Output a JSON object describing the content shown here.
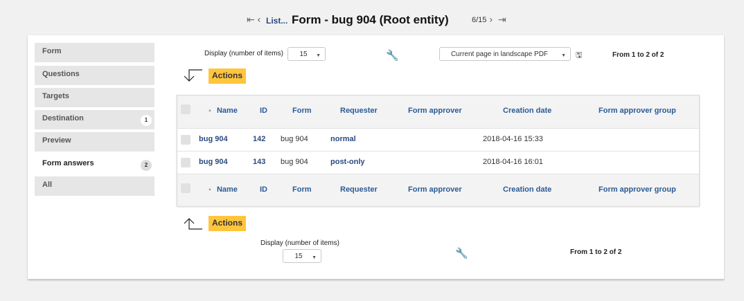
{
  "header": {
    "first_glyph": "⟨",
    "prev_glyph": "‹",
    "list_label": "List...",
    "title": "Form - bug 904 (Root entity)",
    "position": "6/15",
    "next_glyph": "›",
    "last_glyph": "⟩"
  },
  "sidebar": {
    "items": [
      {
        "label": "Form",
        "badge": ""
      },
      {
        "label": "Questions",
        "badge": ""
      },
      {
        "label": "Targets",
        "badge": ""
      },
      {
        "label": "Destination",
        "badge": "1"
      },
      {
        "label": "Preview",
        "badge": ""
      },
      {
        "label": "Form answers",
        "badge": "2"
      },
      {
        "label": "All",
        "badge": ""
      }
    ]
  },
  "top_controls": {
    "display_label": "Display (number of items)",
    "display_value": "15",
    "export_value": "Current page in landscape PDF",
    "pager_text": "From 1 to 2 of 2",
    "actions_label": "Actions"
  },
  "table": {
    "columns": [
      "Name",
      "ID",
      "Form",
      "Requester",
      "Form approver",
      "Creation date",
      "Form approver group"
    ],
    "rows": [
      {
        "name": "bug 904",
        "id": "142",
        "form": "bug 904",
        "requester": "normal",
        "approver": "",
        "date": "2018-04-16 15:33",
        "group": ""
      },
      {
        "name": "bug 904",
        "id": "143",
        "form": "bug 904",
        "requester": "post-only",
        "approver": "",
        "date": "2018-04-16 16:01",
        "group": ""
      }
    ]
  },
  "bottom_controls": {
    "actions_label": "Actions",
    "display_label": "Display (number of items)",
    "display_value": "15",
    "pager_text": "From 1 to 2 of 2"
  },
  "icons": {
    "wrench": "wrench-icon",
    "save": "save-icon",
    "select_caret": "chevron-down-icon",
    "sort": "sort-up-icon"
  },
  "colors": {
    "accent_actions": "#ffc53d",
    "link": "#2b4a80",
    "header_link": "#2b5a95"
  }
}
